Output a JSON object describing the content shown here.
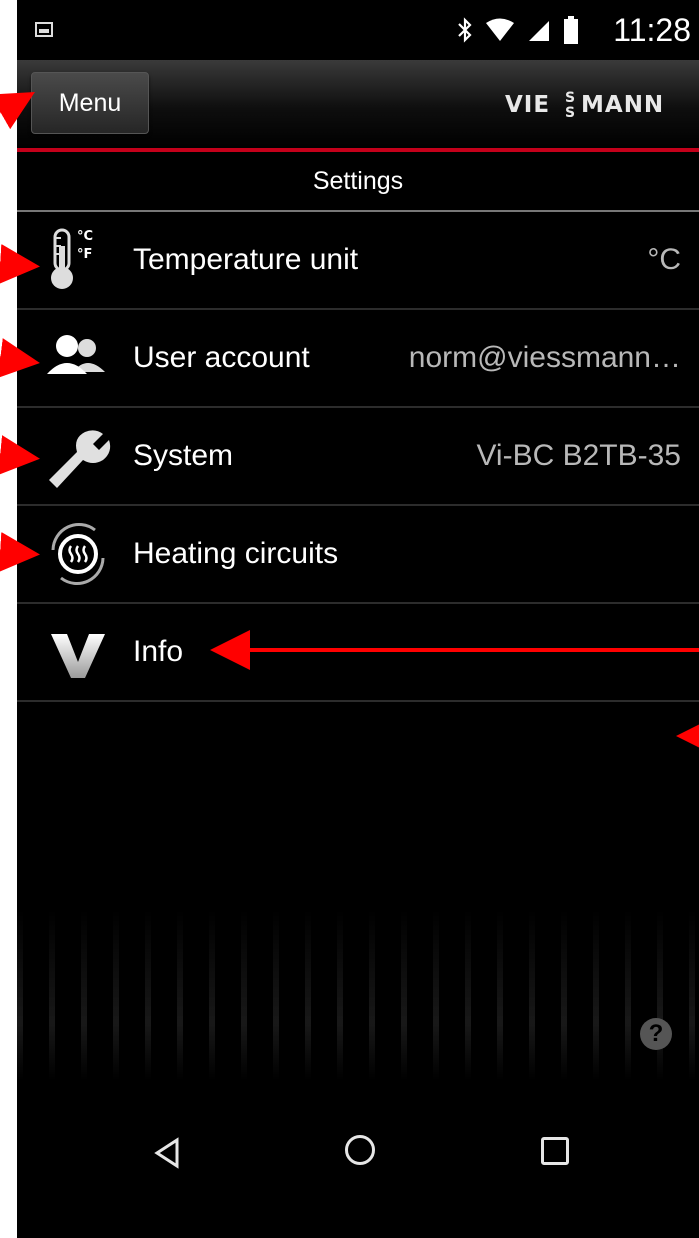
{
  "status_bar": {
    "time": "11:28"
  },
  "header": {
    "menu_label": "Menu",
    "logo_text": "VIESMANN",
    "logo_s_text": "S"
  },
  "page": {
    "title": "Settings"
  },
  "settings": {
    "items": [
      {
        "label": "Temperature unit",
        "value": "°C",
        "icon": "thermometer-icon",
        "icon_text_c": "°C",
        "icon_text_f": "°F"
      },
      {
        "label": "User account",
        "value": "norm@viessmann…",
        "icon": "users-icon"
      },
      {
        "label": "System",
        "value": "Vi-BC B2TB-35",
        "icon": "wrench-icon"
      },
      {
        "label": "Heating circuits",
        "value": "",
        "icon": "heating-circuit-icon"
      },
      {
        "label": "Info",
        "value": "",
        "icon": "viessmann-v-icon"
      }
    ]
  },
  "help": {
    "symbol": "?"
  },
  "colors": {
    "accent": "#c4001a",
    "background": "#000000",
    "annotation": "#ff0000"
  }
}
